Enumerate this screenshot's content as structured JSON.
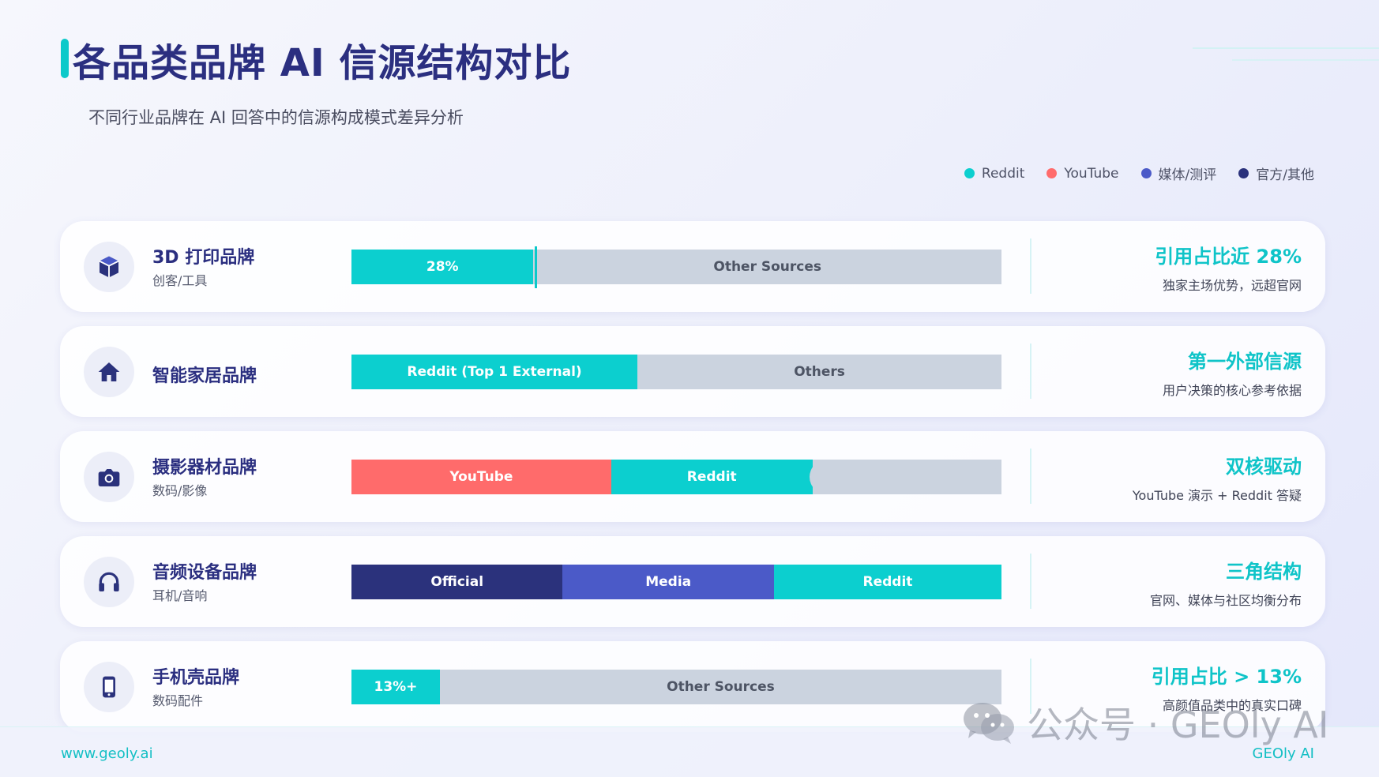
{
  "title": "各品类品牌 AI 信源结构对比",
  "subtitle": "不同行业品牌在 AI 回答中的信源构成模式差异分析",
  "colors": {
    "reddit": "#0ccfcf",
    "youtube": "#ff6b6b",
    "media": "#4b5ac8",
    "official": "#2b327c",
    "other": "#cbd3df"
  },
  "legend": [
    {
      "label": "Reddit",
      "color": "#0ccfcf"
    },
    {
      "label": "YouTube",
      "color": "#ff6b6b"
    },
    {
      "label": "媒体/测评",
      "color": "#4b5ac8"
    },
    {
      "label": "官方/其他",
      "color": "#2b327c"
    }
  ],
  "chart_data": {
    "type": "bar",
    "orientation": "horizontal",
    "stacked": true,
    "unit": "share of citations (%)",
    "rows": [
      {
        "category": "3D 打印品牌",
        "subcategory": "创客/工具",
        "icon": "cube-icon",
        "segments": [
          {
            "label": "28%",
            "source": "Reddit",
            "value": 28,
            "color": "#0ccfcf"
          },
          {
            "label": "Other Sources",
            "source": "Other",
            "value": 72,
            "color": "#cbd3df"
          }
        ],
        "stat_title": "引用占比近 28%",
        "stat_desc": "独家主场优势，远超官网"
      },
      {
        "category": "智能家居品牌",
        "subcategory": "",
        "icon": "home-icon",
        "segments": [
          {
            "label": "Reddit (Top 1 External)",
            "source": "Reddit",
            "value": 44,
            "color": "#0ccfcf"
          },
          {
            "label": "Others",
            "source": "Other",
            "value": 56,
            "color": "#cbd3df"
          }
        ],
        "stat_title": "第一外部信源",
        "stat_desc": "用户决策的核心参考依据"
      },
      {
        "category": "摄影器材品牌",
        "subcategory": "数码/影像",
        "icon": "camera-icon",
        "segments": [
          {
            "label": "YouTube",
            "source": "YouTube",
            "value": 40,
            "color": "#ff6b6b"
          },
          {
            "label": "Reddit",
            "source": "Reddit",
            "value": 31,
            "color": "#0ccfcf"
          },
          {
            "label": "",
            "source": "Other",
            "value": 29,
            "color": "#cbd3df"
          }
        ],
        "stat_title": "双核驱动",
        "stat_desc": "YouTube 演示 + Reddit 答疑"
      },
      {
        "category": "音频设备品牌",
        "subcategory": "耳机/音响",
        "icon": "headphones-icon",
        "segments": [
          {
            "label": "Official",
            "source": "官方/其他",
            "value": 32.5,
            "color": "#2b327c"
          },
          {
            "label": "Media",
            "source": "媒体/测评",
            "value": 32.5,
            "color": "#4b5ac8"
          },
          {
            "label": "Reddit",
            "source": "Reddit",
            "value": 35,
            "color": "#0ccfcf"
          }
        ],
        "stat_title": "三角结构",
        "stat_desc": "官网、媒体与社区均衡分布"
      },
      {
        "category": "手机壳品牌",
        "subcategory": "数码配件",
        "icon": "phone-icon",
        "segments": [
          {
            "label": "13%+",
            "source": "Reddit",
            "value": 13.6,
            "color": "#0ccfcf"
          },
          {
            "label": "Other Sources",
            "source": "Other",
            "value": 86.4,
            "color": "#cbd3df"
          }
        ],
        "stat_title": "引用占比 > 13%",
        "stat_desc": "高颜值品类中的真实口碑"
      }
    ]
  },
  "footer": {
    "url": "www.geoly.ai",
    "brand": "GEOly AI"
  },
  "watermark": {
    "icon": "wechat-icon",
    "text": "公众号 · GEOly AI"
  }
}
